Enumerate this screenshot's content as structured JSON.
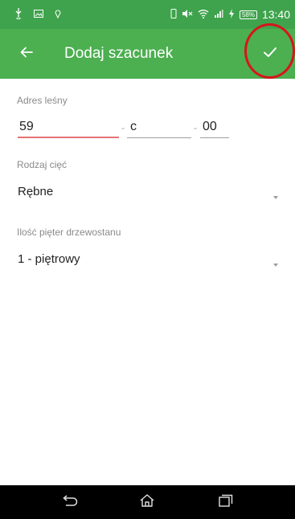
{
  "status_bar": {
    "battery": "58%",
    "time": "13:40"
  },
  "app_bar": {
    "title": "Dodaj szacunek",
    "back_icon": "arrow-back-icon",
    "confirm_icon": "check-icon"
  },
  "form": {
    "address": {
      "label": "Adres leśny",
      "part1": "59",
      "sep1": "-",
      "part2": "c",
      "sep2": "-",
      "part3": "00"
    },
    "cut_type": {
      "label": "Rodzaj cięć",
      "value": "Rębne"
    },
    "storeys": {
      "label": "Ilość pięter drzewostanu",
      "value": "1 - piętrowy"
    }
  },
  "colors": {
    "status_bar": "#3fa34d",
    "app_bar": "#4caf50",
    "accent_underline": "#e57373",
    "highlight_ring": "#d8141c"
  }
}
